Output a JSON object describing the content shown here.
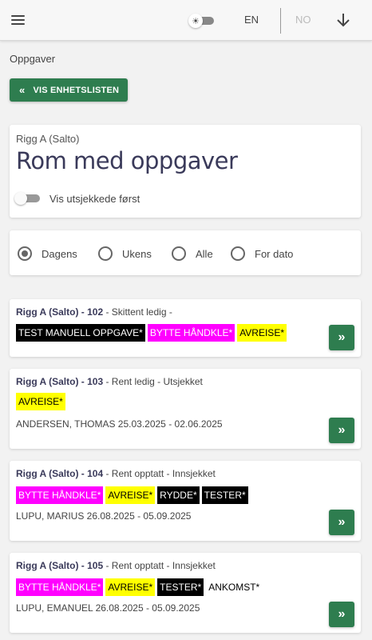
{
  "header": {
    "lang_en": "EN",
    "lang_no": "NO"
  },
  "breadcrumb": "Oppgaver",
  "back_button": "VIS ENHETSLISTEN",
  "title_card": {
    "subtitle": "Rigg A (Salto)",
    "title": "Rom med oppgaver",
    "toggle_label": "Vis utsjekkede først"
  },
  "filters": [
    {
      "label": "Dagens",
      "checked": true
    },
    {
      "label": "Ukens",
      "checked": false
    },
    {
      "label": "Alle",
      "checked": false
    },
    {
      "label": "For dato",
      "checked": false
    }
  ],
  "rooms": [
    {
      "name": "Rigg A (Salto) - 102",
      "status": " - Skittent ledig -",
      "tags": [
        {
          "text": "TEST MANUELL OPPGAVE*",
          "color": "black"
        },
        {
          "text": "BYTTE HÅNDKLE*",
          "color": "magenta"
        },
        {
          "text": "AVREISE*",
          "color": "yellow"
        }
      ],
      "guest": ""
    },
    {
      "name": "Rigg A (Salto) - 103",
      "status": " - Rent ledig - Utsjekket",
      "tags": [
        {
          "text": "AVREISE*",
          "color": "yellow"
        }
      ],
      "guest": "ANDERSEN, THOMAS 25.03.2025 - 02.06.2025"
    },
    {
      "name": "Rigg A (Salto) - 104",
      "status": " - Rent opptatt - Innsjekket",
      "tags": [
        {
          "text": "BYTTE HÅNDKLE*",
          "color": "magenta"
        },
        {
          "text": "AVREISE*",
          "color": "yellow"
        },
        {
          "text": "RYDDE*",
          "color": "black"
        },
        {
          "text": "TESTER*",
          "color": "black"
        }
      ],
      "guest": "LUPU, MARIUS 26.08.2025 - 05.09.2025"
    },
    {
      "name": "Rigg A (Salto) - 105",
      "status": " - Rent opptatt - Innsjekket",
      "tags": [
        {
          "text": "BYTTE HÅNDKLE*",
          "color": "magenta"
        },
        {
          "text": "AVREISE*",
          "color": "yellow"
        },
        {
          "text": "TESTER*",
          "color": "black"
        },
        {
          "text": "ANKOMST*",
          "color": "plain"
        }
      ],
      "guest": "LUPU, EMANUEL 26.08.2025 - 05.09.2025"
    }
  ]
}
